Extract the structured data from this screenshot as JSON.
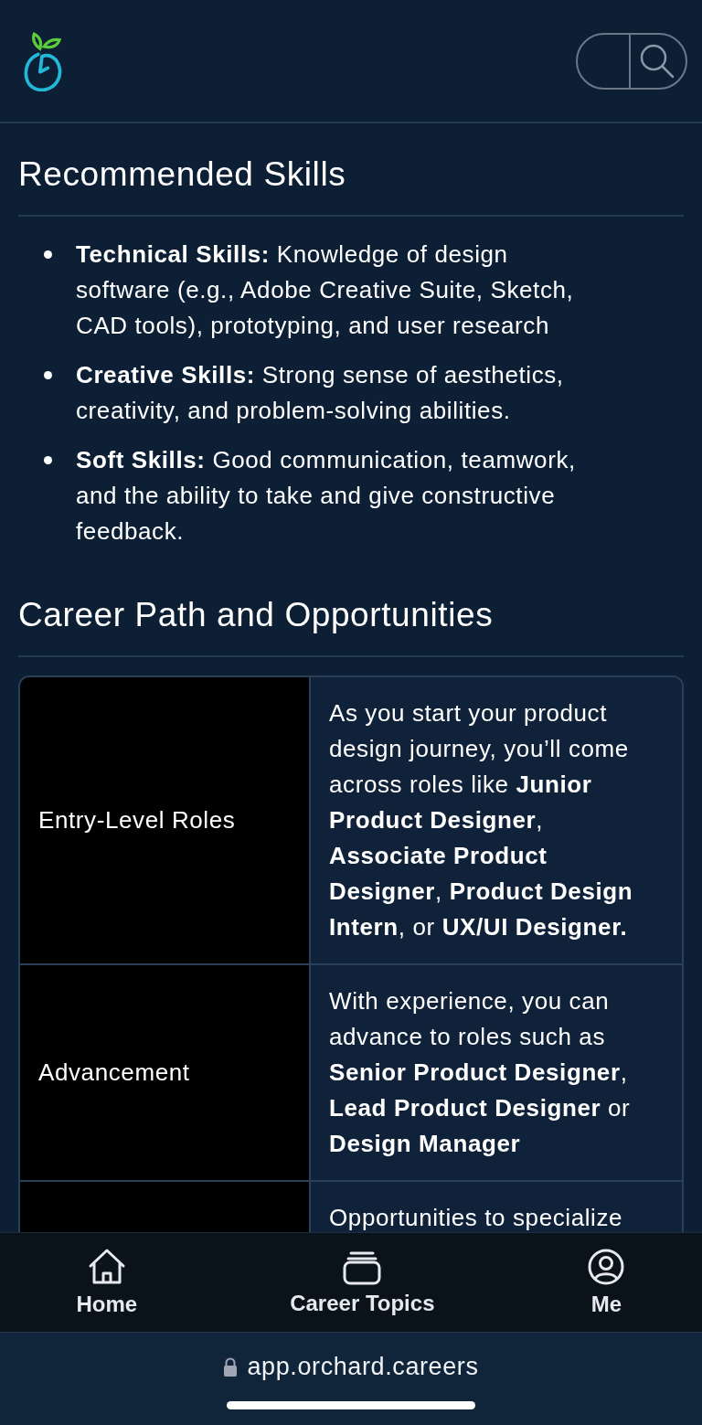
{
  "sections": [
    {
      "heading": "Recommended Skills",
      "kind": "bullets",
      "items": [
        "**Technical Skills:** Knowledge of design software (e.g., Adobe Creative Suite, Sketch, CAD tools), prototyping, and user research",
        "**Creative Skills:** Strong sense of aesthetics, creativity, and problem-solving abilities.",
        "**Soft Skills:** Good communication, teamwork, and the ability to take and give constructive feedback."
      ]
    },
    {
      "heading": "Career Path and Opportunities",
      "kind": "table",
      "rows": [
        {
          "label": "Entry-Level Roles",
          "text": "As you start your product design journey, you’ll come across roles like **Junior Product Designer**, **Associate Product Designer**, **Product Design Intern**, or **UX/UI Designer.**"
        },
        {
          "label": "Advancement",
          "text": "With experience, you can advance to roles such as **Senior Product Designer**, **Lead Product Designer** or **Design Manager**"
        },
        {
          "label": "",
          "text": "Opportunities to specialize"
        }
      ]
    }
  ],
  "nav": [
    {
      "label": "Home",
      "kind": "home"
    },
    {
      "label": "Career Topics",
      "kind": "topics"
    },
    {
      "label": "Me",
      "kind": "profile"
    }
  ],
  "url_bar": {
    "url": "app.orchard.careers"
  }
}
